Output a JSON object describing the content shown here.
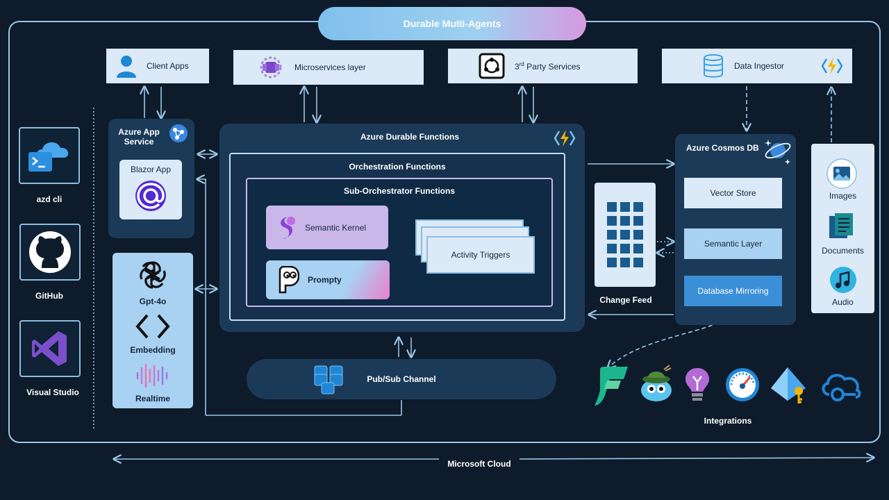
{
  "title": "Durable Multi-Agents",
  "top_services": {
    "client_apps": "Client Apps",
    "microservices": "Microservices layer",
    "third_party_prefix": "3",
    "third_party_sup": "rd",
    "third_party_suffix": " Party Services",
    "data_ingestor": "Data Ingestor"
  },
  "tools": {
    "azd": "azd cli",
    "github": "GitHub",
    "vs": "Visual Studio"
  },
  "app_service": {
    "title": "Azure App Service",
    "blazor": "Blazor App"
  },
  "models": {
    "gpt": "Gpt-4o",
    "embedding": "Embedding",
    "realtime": "Realtime"
  },
  "durable": {
    "title": "Azure Durable Functions",
    "orchestration": "Orchestration Functions",
    "sub_orchestrator": "Sub-Orchestrator Functions",
    "semantic_kernel": "Semantic Kernel",
    "prompty": "Prompty",
    "activity_triggers": "Activity Triggers"
  },
  "pubsub": "Pub/Sub Channel",
  "change_feed": "Change Feed",
  "cosmos": {
    "title": "Azure Cosmos DB",
    "vector_store": "Vector Store",
    "semantic_layer": "Semantic Layer",
    "db_mirroring": "Database Mirroring"
  },
  "media": {
    "images": "Images",
    "documents": "Documents",
    "audio": "Audio"
  },
  "integrations": "Integrations",
  "microsoft_cloud": "Microsoft Cloud",
  "colors": {
    "background": "#0d1b2a",
    "panel": "#1b3a57",
    "light_box": "#dbeaf6",
    "accent_blue": "#3b8fd6",
    "line": "#9cc6e6"
  }
}
